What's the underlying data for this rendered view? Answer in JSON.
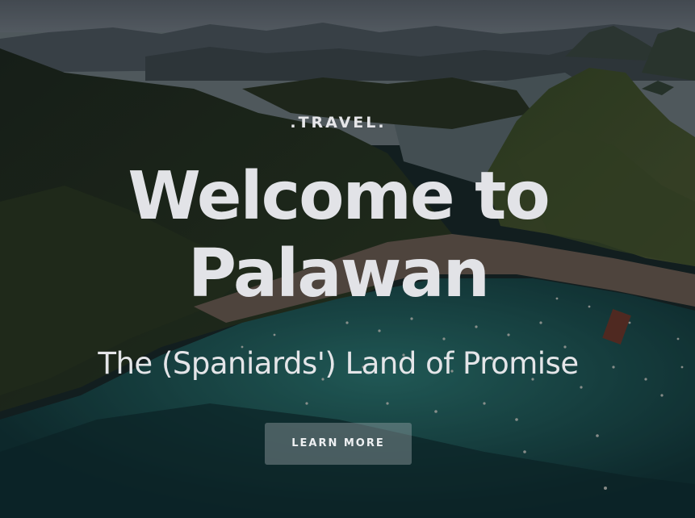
{
  "hero": {
    "eyebrow": ".TRAVEL.",
    "title_line1": "Welcome to",
    "title_line2": "Palawan",
    "subtitle": "The (Spaniards') Land of Promise",
    "cta_label": "LEARN MORE"
  }
}
